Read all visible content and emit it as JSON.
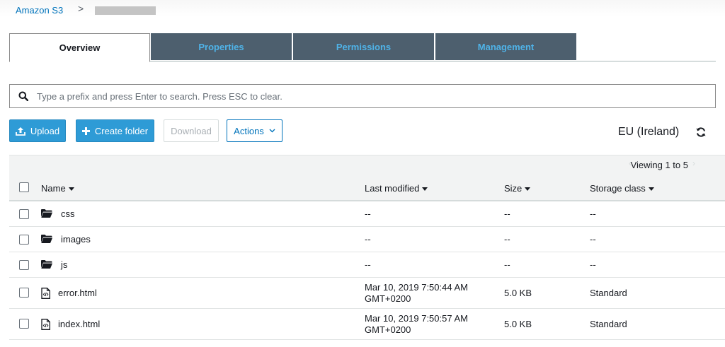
{
  "breadcrumb": {
    "root": "Amazon S3",
    "separator": ">"
  },
  "tabs": [
    {
      "label": "Overview"
    },
    {
      "label": "Properties"
    },
    {
      "label": "Permissions"
    },
    {
      "label": "Management"
    }
  ],
  "search": {
    "placeholder": "Type a prefix and press Enter to search. Press ESC to clear."
  },
  "toolbar": {
    "upload": "Upload",
    "create_folder": "Create folder",
    "download": "Download",
    "actions": "Actions",
    "region": "EU (Ireland)"
  },
  "viewing": "Viewing 1 to 5",
  "table": {
    "headers": {
      "name": "Name",
      "modified": "Last modified",
      "size": "Size",
      "class": "Storage class"
    },
    "rows": [
      {
        "name": "css",
        "type": "folder",
        "modified_1": "--",
        "modified_2": "",
        "size": "--",
        "class": "--"
      },
      {
        "name": "images",
        "type": "folder",
        "modified_1": "--",
        "modified_2": "",
        "size": "--",
        "class": "--"
      },
      {
        "name": "js",
        "type": "folder",
        "modified_1": "--",
        "modified_2": "",
        "size": "--",
        "class": "--"
      },
      {
        "name": "error.html",
        "type": "file",
        "modified_1": "Mar 10, 2019 7:50:44 AM",
        "modified_2": "GMT+0200",
        "size": "5.0 KB",
        "class": "Standard"
      },
      {
        "name": "index.html",
        "type": "file",
        "modified_1": "Mar 10, 2019 7:50:57 AM",
        "modified_2": "GMT+0200",
        "size": "5.0 KB",
        "class": "Standard"
      }
    ]
  },
  "colors": {
    "accent": "#2e9bd6",
    "link": "#0073bb",
    "tab_bg": "#4d5f6e",
    "tab_text": "#4fb3e8"
  }
}
